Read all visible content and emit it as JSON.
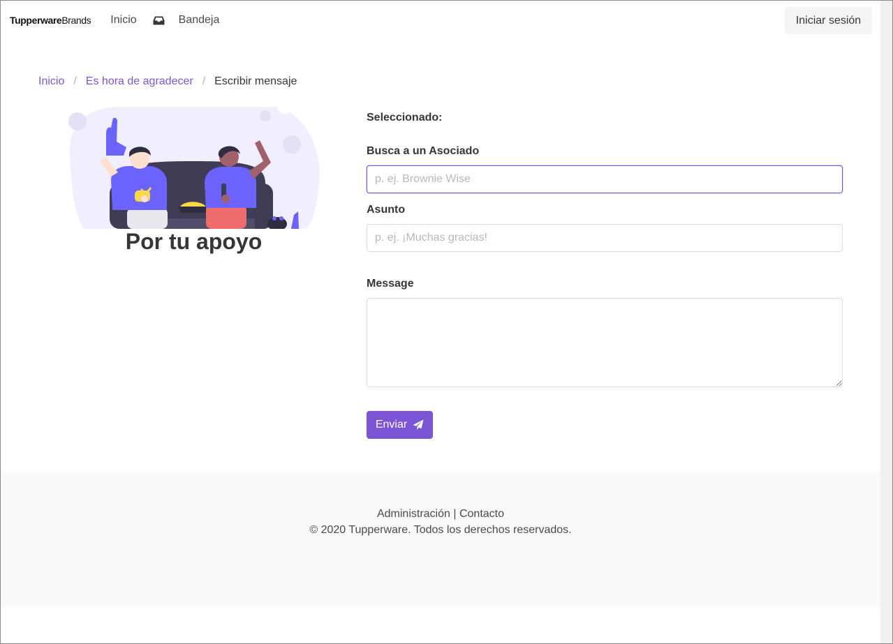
{
  "navbar": {
    "brand_bold": "Tupperware",
    "brand_light": "Brands",
    "home_label": "Inicio",
    "inbox_label": "Bandeja",
    "login_label": "Iniciar sesión"
  },
  "breadcrumb": {
    "items": [
      "Inicio",
      "Es hora de agradecer"
    ],
    "current": "Escribir mensaje",
    "separator": "/"
  },
  "hero": {
    "title": "Por tu apoyo"
  },
  "form": {
    "selected_label": "Seleccionado:",
    "search_label": "Busca a un Asociado",
    "search_placeholder": "p. ej. Brownie Wise",
    "subject_label": "Asunto",
    "subject_placeholder": "p. ej. ¡Muchas gracias!",
    "message_label": "Message",
    "send_label": "Enviar"
  },
  "footer": {
    "admin_link": "Administración",
    "divider": "|",
    "contact_link": "Contacto",
    "copyright": "© 2020 Tupperware. Todos los derechos reservados."
  },
  "colors": {
    "accent": "#7b55d6",
    "illustration_primary": "#6c63ff",
    "illustration_bg": "#f0eeff",
    "footer_bg": "#fafafa"
  },
  "icons": {
    "inbox": "inbox-icon",
    "send": "paper-plane-icon"
  }
}
